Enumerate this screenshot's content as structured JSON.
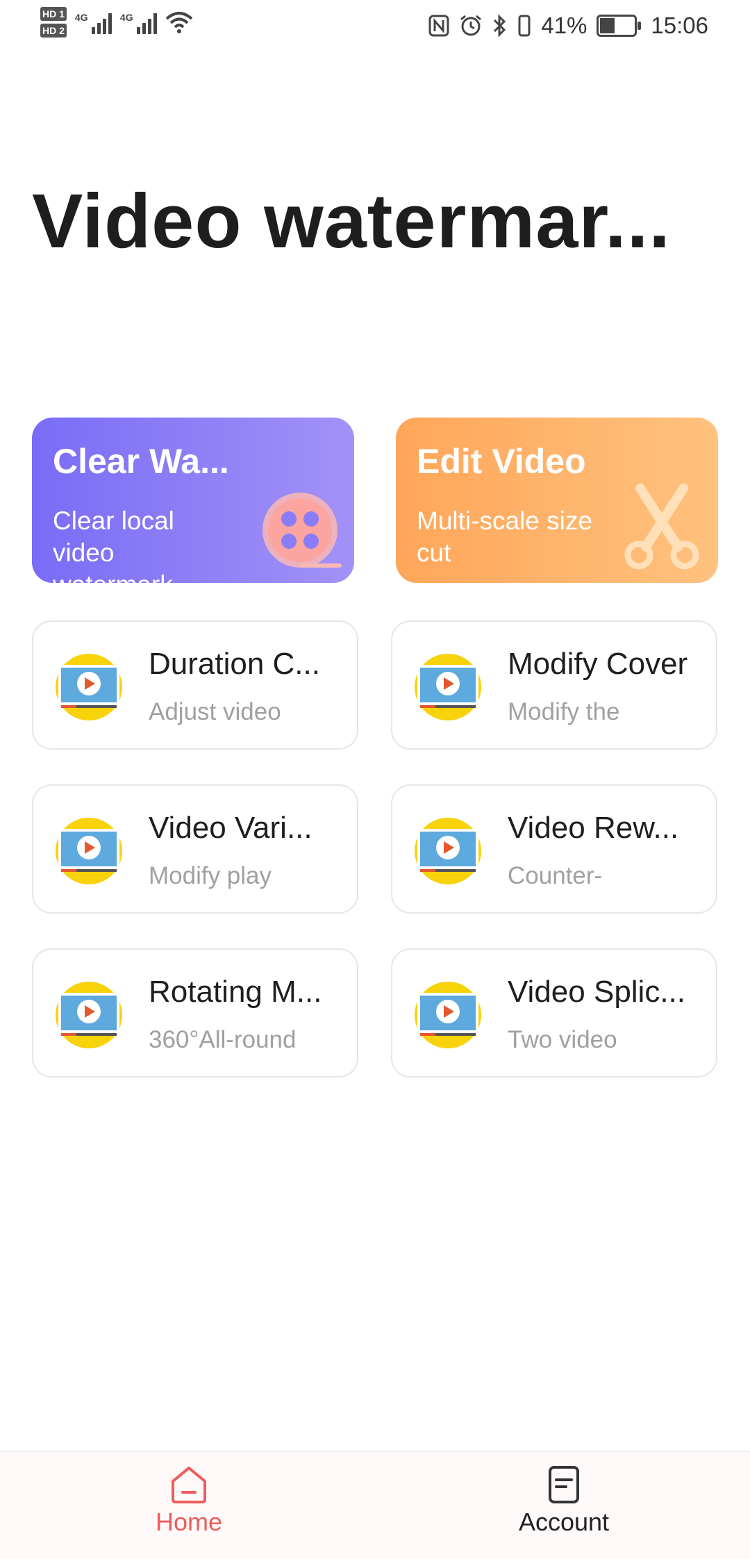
{
  "status_bar": {
    "sim1": "HD 1",
    "sim2": "HD 2",
    "network1": "4G",
    "network2": "4G",
    "battery_percent": "41%",
    "time": "15:06",
    "icons": [
      "nfc-icon",
      "alarm-icon",
      "bluetooth-icon",
      "vibrate-icon",
      "battery-icon",
      "wifi-icon"
    ]
  },
  "header": {
    "title": "Video watermar..."
  },
  "features": [
    {
      "title": "Clear Wa...",
      "subtitle": "Clear local video watermark",
      "icon": "film-reel-icon",
      "color_from": "#7a6cf6",
      "color_to": "#a292f7"
    },
    {
      "title": "Edit Video",
      "subtitle": "Multi-scale size cut",
      "icon": "scissors-icon",
      "color_from": "#ffa659",
      "color_to": "#ffc27f"
    }
  ],
  "tools": [
    {
      "name": "Duration C...",
      "desc": "Adjust video",
      "icon": "video-play-icon"
    },
    {
      "name": "Modify Cover",
      "desc": "Modify the",
      "icon": "video-play-icon"
    },
    {
      "name": "Video Vari...",
      "desc": "Modify play",
      "icon": "video-play-icon"
    },
    {
      "name": "Video Rew...",
      "desc": "Counter-",
      "icon": "video-play-icon"
    },
    {
      "name": "Rotating M...",
      "desc": "360°All-round",
      "icon": "video-play-icon"
    },
    {
      "name": "Video Splic...",
      "desc": "Two video",
      "icon": "video-play-icon"
    }
  ],
  "bottom_nav": {
    "home_label": "Home",
    "account_label": "Account",
    "active_color": "#ee5c5c"
  }
}
